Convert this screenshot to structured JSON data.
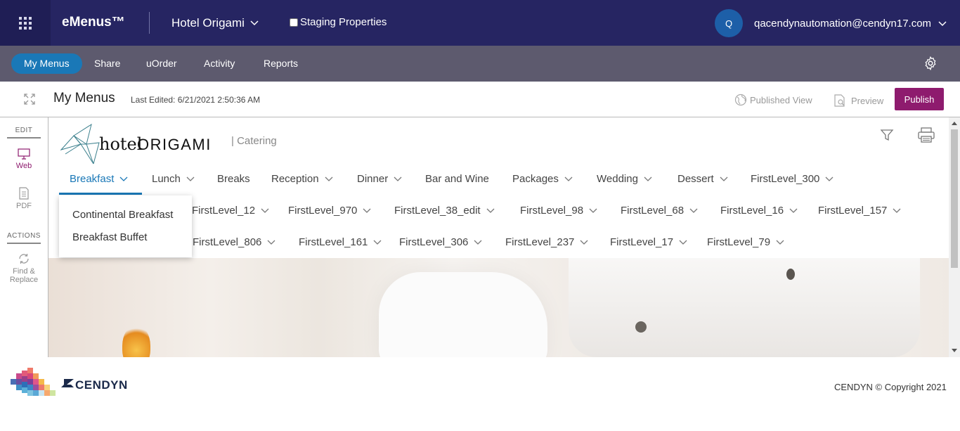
{
  "topbar": {
    "brand": "eMenus™",
    "property": "Hotel Origami",
    "staging_label": "Staging Properties",
    "staging_checked": false,
    "avatar_initial": "Q",
    "user_email": "qacendynautomation@cendyn17.com"
  },
  "nav": {
    "items": [
      {
        "label": "My Menus",
        "active": true
      },
      {
        "label": "Share"
      },
      {
        "label": "uOrder"
      },
      {
        "label": "Activity"
      },
      {
        "label": "Reports"
      }
    ]
  },
  "header": {
    "title": "My Menus",
    "last_edited": "Last Edited: 6/21/2021 2:50:36 AM",
    "published_view": "Published View",
    "preview": "Preview",
    "publish": "Publish"
  },
  "left_panel": {
    "edit_heading": "EDIT",
    "web": "Web",
    "pdf": "PDF",
    "actions_heading": "ACTIONS",
    "find_replace_1": "Find &",
    "find_replace_2": "Replace"
  },
  "canvas": {
    "logo_text_1": "hotel",
    "logo_text_2": "ORIGAMI",
    "subtitle": "| Catering",
    "menu_row_1": [
      "Breakfast",
      "Lunch",
      "Breaks",
      "Reception",
      "Dinner",
      "Bar and Wine",
      "Packages",
      "Wedding",
      "Dessert",
      "FirstLevel_300"
    ],
    "menu_row_2": [
      "FirstLevel_12",
      "FirstLevel_970",
      "FirstLevel_38_edit",
      "FirstLevel_98",
      "FirstLevel_68",
      "FirstLevel_16",
      "FirstLevel_157"
    ],
    "menu_row_3": [
      "FirstLevel_806",
      "FirstLevel_161",
      "FirstLevel_306",
      "FirstLevel_237",
      "FirstLevel_17",
      "FirstLevel_79"
    ],
    "dropdown": [
      "Continental Breakfast",
      "Breakfast Buffet"
    ]
  },
  "footer": {
    "logo_text": "CENDYN",
    "copyright": "CENDYN © Copyright 2021"
  },
  "colors": {
    "topbar": "#262562",
    "nav": "#5d5a6e",
    "accent": "#1a78b7",
    "publish": "#8e1b6e"
  }
}
